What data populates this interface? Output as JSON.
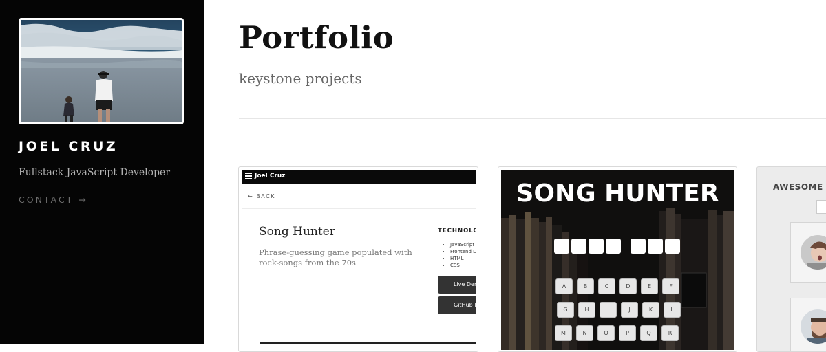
{
  "sidebar": {
    "name": "JOEL CRUZ",
    "tagline": "Fullstack JavaScript Developer",
    "contact_label": "CONTACT →"
  },
  "main": {
    "title": "Portfolio",
    "subtitle": "keystone projects"
  },
  "projects": [
    {
      "nav_brand": "Joel Cruz",
      "back_label": "← BACK",
      "title": "Song Hunter",
      "description": "Phrase-guessing game populated with rock-songs from the 70s",
      "tech_heading": "TECHNOLO",
      "technologies": [
        "JavaScript",
        "Frontend D",
        "HTML",
        "CSS"
      ],
      "live_demo_label": "Live Der",
      "github_label": "GitHub Re"
    },
    {
      "game_title": "SONG HUNTER",
      "keyboard_rows": [
        [
          "A",
          "B",
          "C",
          "D",
          "E",
          "F"
        ],
        [
          "G",
          "H",
          "I",
          "J",
          "K",
          "L"
        ],
        [
          "M",
          "N",
          "O",
          "P",
          "Q",
          "R"
        ]
      ]
    },
    {
      "title": "AWESOME S"
    }
  ],
  "colors": {
    "sidebar_bg": "#050505",
    "title": "#111111",
    "subtitle": "#666666",
    "button_dark": "#333333"
  }
}
